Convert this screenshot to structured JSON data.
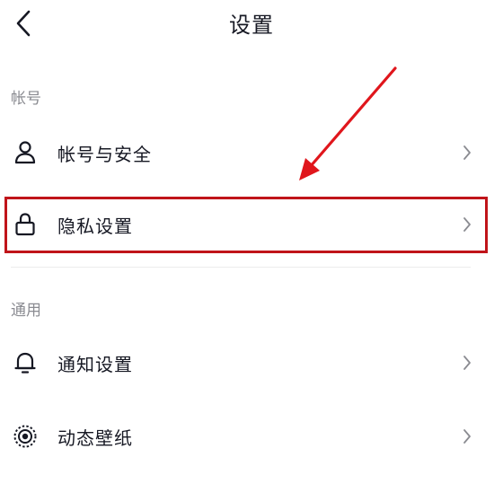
{
  "header": {
    "title": "设置",
    "back_icon": "chevron-left-icon"
  },
  "sections": [
    {
      "label": "帐号",
      "items": [
        {
          "label": "帐号与安全",
          "icon": "user-icon"
        },
        {
          "label": "隐私设置",
          "icon": "lock-icon",
          "highlighted": true
        }
      ]
    },
    {
      "label": "通用",
      "items": [
        {
          "label": "通知设置",
          "icon": "bell-icon"
        },
        {
          "label": "动态壁纸",
          "icon": "live-wallpaper-icon"
        }
      ]
    }
  ],
  "colors": {
    "highlight": "#c0141a",
    "annotation_arrow": "#e0161c",
    "section_label": "#8a8b91"
  }
}
